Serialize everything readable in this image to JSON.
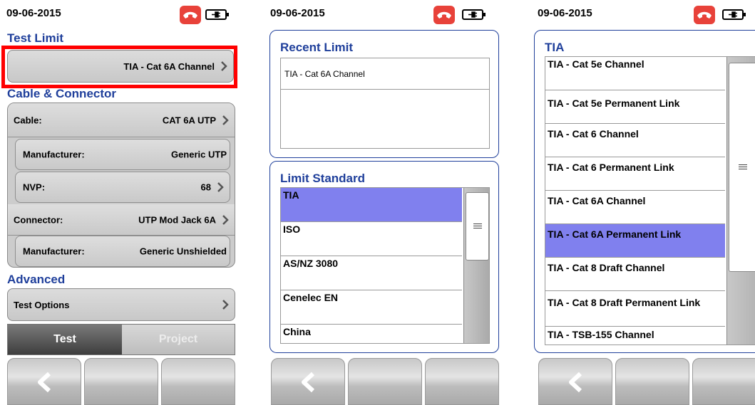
{
  "screen1": {
    "date": "09-06-2015",
    "test_limit_title": "Test Limit",
    "test_limit_value": "TIA - Cat 6A Channel",
    "cable_connector_title": "Cable & Connector",
    "rows": [
      {
        "label": "Cable:",
        "value": "CAT 6A UTP"
      },
      {
        "label": "Manufacturer:",
        "value": "Generic UTP"
      },
      {
        "label": "NVP:",
        "value": "68"
      },
      {
        "label": "Connector:",
        "value": "UTP Mod Jack 6A"
      },
      {
        "label": "Manufacturer:",
        "value": "Generic Unshielded"
      }
    ],
    "advanced_title": "Advanced",
    "test_options_label": "Test Options",
    "tabs": {
      "test": "Test",
      "project": "Project"
    }
  },
  "screen2": {
    "date": "09-06-2015",
    "recent_limit_title": "Recent Limit",
    "recent_items": [
      "TIA - Cat 6A Channel"
    ],
    "limit_standard_title": "Limit Standard",
    "standards": [
      "TIA",
      "ISO",
      "AS/NZ 3080",
      "Cenelec EN",
      "China"
    ],
    "selected_standard": "TIA"
  },
  "screen3": {
    "date": "09-06-2015",
    "title": "TIA",
    "limits": [
      "TIA - Cat 5e Channel",
      "TIA - Cat 5e Permanent Link",
      "TIA - Cat 6 Channel",
      "TIA - Cat 6 Permanent Link",
      "TIA - Cat 6A Channel",
      "TIA - Cat 6A Permanent Link",
      "TIA - Cat 8 Draft Channel",
      "TIA - Cat 8 Draft Permanent Link",
      "TIA - TSB-155 Channel"
    ],
    "selected_limit": "TIA - Cat 6A Permanent Link"
  },
  "icons": {
    "status_phone": "phone-hangup-icon",
    "status_battery": "battery-plug-icon",
    "back": "back-chevron-icon",
    "row_arrow": "chevron-right-icon"
  },
  "colors": {
    "accent": "#1f3f9b",
    "selected_row": "#8080ee",
    "highlight_border": "#ff0000",
    "phone_icon": "#e8423a"
  }
}
